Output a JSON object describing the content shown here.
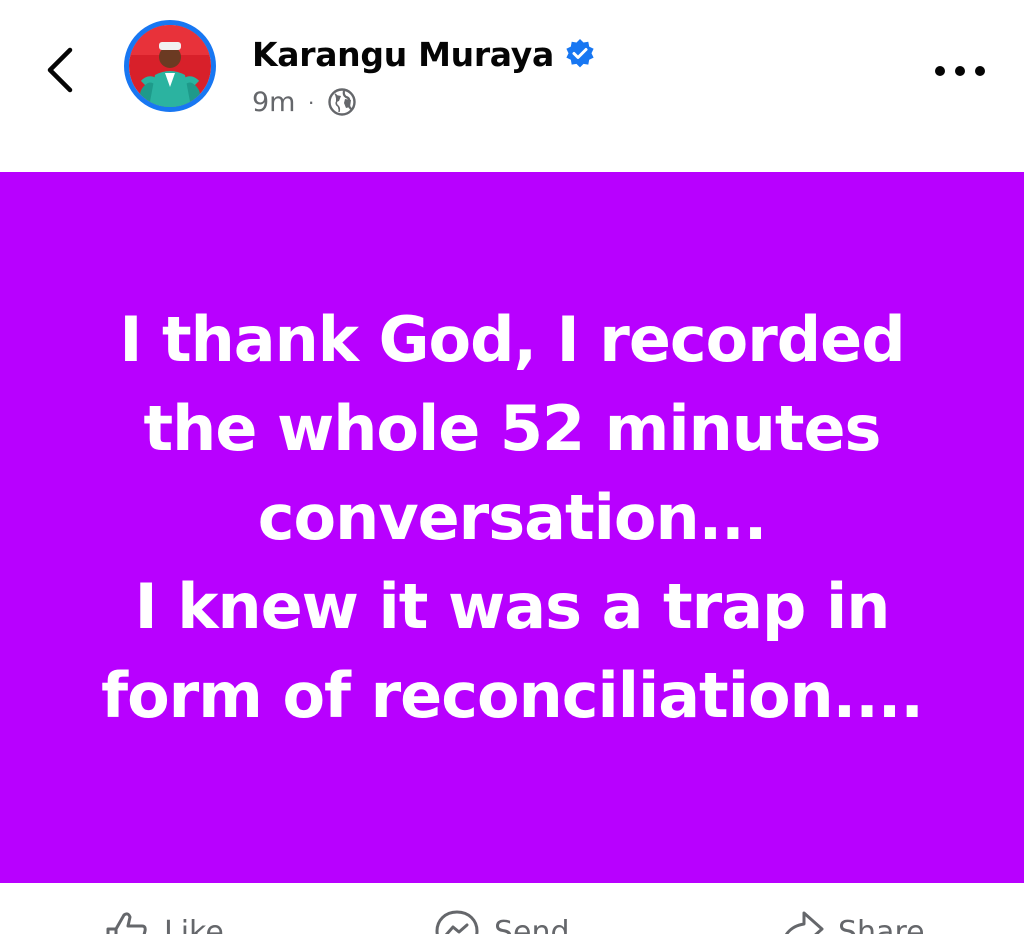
{
  "header": {
    "author_name": "Karangu Muraya",
    "post_time": "9m",
    "meta_separator": "·",
    "icons": {
      "back": "chevron-left-icon",
      "verified": "verified-badge-icon",
      "privacy": "globe-icon",
      "more": "more-dots-icon"
    }
  },
  "post": {
    "background_color": "#b800ff",
    "text_color": "#ffffff",
    "lines": [
      "I thank God, I recorded",
      "the whole 52 minutes",
      "conversation...",
      "I knew it was a trap in",
      "form of reconciliation...."
    ]
  },
  "actions": {
    "like_label": "Like",
    "send_label": "Send",
    "share_label": "Share",
    "icons": [
      "thumbs-up-icon",
      "messenger-icon",
      "share-arrow-icon"
    ]
  },
  "colors": {
    "accent": "#1877f2",
    "secondary_text": "#65676b",
    "primary_text": "#050505"
  }
}
